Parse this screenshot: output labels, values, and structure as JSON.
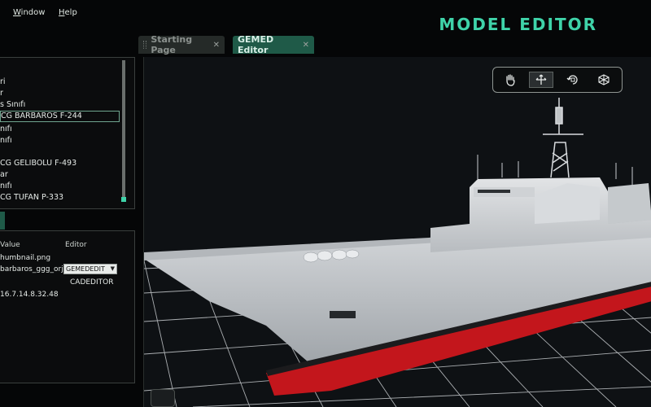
{
  "menu": {
    "window": "Window",
    "window_u": "W",
    "window_rest": "indow",
    "help": "Help",
    "help_u": "H",
    "help_rest": "elp"
  },
  "app_title": "MODEL EDITOR",
  "tabs": [
    {
      "label": "Starting Page",
      "active": false
    },
    {
      "label": "GEMED Editor",
      "active": true
    }
  ],
  "tree": {
    "items": [
      {
        "label": "ri"
      },
      {
        "label": "r"
      },
      {
        "label": "s Sınıfı"
      },
      {
        "label": "CG BARBAROS F-244",
        "selected": true
      },
      {
        "label": "nıfı"
      },
      {
        "label": "nıfı"
      },
      {
        "label": ""
      },
      {
        "label": "CG GELIBOLU F-493"
      },
      {
        "label": "ar"
      },
      {
        "label": "nıfı"
      },
      {
        "label": "CG TUFAN P-333"
      }
    ]
  },
  "properties": {
    "headers": {
      "value": "Value",
      "editor": "Editor"
    },
    "rows": [
      {
        "value": "humbnail.png",
        "editor": ""
      },
      {
        "value": "barbaros_ggg_orj...",
        "editor": "GEMEDEDIT"
      },
      {
        "value": "",
        "editor": "CADEDITOR"
      },
      {
        "value": "16.7.14.8.32.48",
        "editor": ""
      }
    ]
  },
  "toolbar": {
    "tools": [
      {
        "name": "pan-hand-icon"
      },
      {
        "name": "move-arrows-icon",
        "active": true
      },
      {
        "name": "rotate-icon"
      },
      {
        "name": "scale-cube-icon"
      }
    ]
  },
  "colors": {
    "accent": "#3fd3a9",
    "tab_active": "#1f5a48",
    "hull": "#c9ccd0",
    "hull_red": "#c3161c"
  }
}
